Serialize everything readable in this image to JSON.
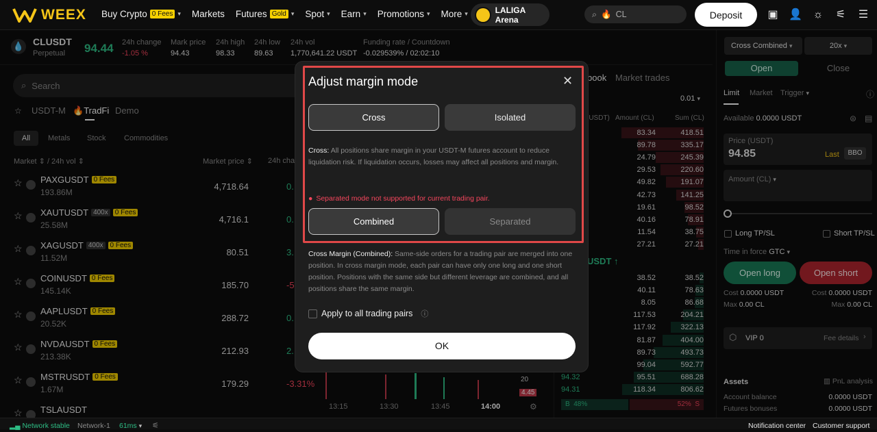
{
  "nav": {
    "brand": "WEEX",
    "items": [
      {
        "label": "Buy Crypto",
        "tag": "0 Fees",
        "chevron": true
      },
      {
        "label": "Markets"
      },
      {
        "label": "Futures",
        "tag": "Gold",
        "chevron": true
      },
      {
        "label": "Spot",
        "chevron": true
      },
      {
        "label": "Earn",
        "chevron": true
      },
      {
        "label": "Promotions",
        "chevron": true
      },
      {
        "label": "More",
        "chevron": true
      }
    ],
    "arena_label": "LALIGA Arena",
    "search_value": "CL",
    "deposit_label": "Deposit"
  },
  "ticker": {
    "symbol": "CLUSDT",
    "type": "Perpetual",
    "last_price": "94.44",
    "stats": [
      {
        "label": "24h change",
        "value": "-1.05 %",
        "tone": "red"
      },
      {
        "label": "Mark price",
        "value": "94.43"
      },
      {
        "label": "24h high",
        "value": "98.33"
      },
      {
        "label": "24h low",
        "value": "89.63"
      },
      {
        "label": "24h vol",
        "value": "1,770,641.22 USDT"
      },
      {
        "label": "Funding rate / Countdown",
        "value": "-0.029539% / 02:02:10"
      }
    ]
  },
  "market_list": {
    "search_placeholder": "Search",
    "tabs": [
      "USDT-M",
      "TradFi",
      "Demo"
    ],
    "active_tab": "TradFi",
    "filters": [
      "All",
      "Metals",
      "Stock",
      "Commodities"
    ],
    "col_market": "Market ⇕ / 24h vol ⇕",
    "col_price": "Market price ⇕",
    "col_change": "24h chan",
    "rows": [
      {
        "symbol": "PAXGUSDT",
        "lev": "",
        "fees": "0 Fees",
        "vol": "193.86M",
        "price": "4,718.64",
        "change": "0.",
        "tone": "green"
      },
      {
        "symbol": "XAUTUSDT",
        "lev": "400x",
        "fees": "0 Fees",
        "vol": "25.58M",
        "price": "4,716.1",
        "change": "0.",
        "tone": "green"
      },
      {
        "symbol": "XAGUSDT",
        "lev": "400x",
        "fees": "0 Fees",
        "vol": "11.52M",
        "price": "80.51",
        "change": "3.",
        "tone": "green"
      },
      {
        "symbol": "COINUSDT",
        "lev": "",
        "fees": "0 Fees",
        "vol": "145.14K",
        "price": "185.70",
        "change": "-5.",
        "tone": "red"
      },
      {
        "symbol": "AAPLUSDT",
        "lev": "",
        "fees": "0 Fees",
        "vol": "20.52K",
        "price": "288.72",
        "change": "0.",
        "tone": "green"
      },
      {
        "symbol": "NVDAUSDT",
        "lev": "",
        "fees": "0 Fees",
        "vol": "213.38K",
        "price": "212.93",
        "change": "2.",
        "tone": "green"
      },
      {
        "symbol": "MSTRUSDT",
        "lev": "",
        "fees": "0 Fees",
        "vol": "1.67M",
        "price": "179.29",
        "change": "-3.31%",
        "tone": "red"
      },
      {
        "symbol": "TSLAUSDT",
        "lev": "",
        "fees": "",
        "vol": "",
        "price": "",
        "change": "",
        "tone": "green"
      }
    ]
  },
  "chart": {
    "times": [
      "13:15",
      "13:30",
      "13:45",
      "14:00"
    ],
    "labels": [
      "20",
      "4.45"
    ]
  },
  "orderbook": {
    "tabs": [
      "book",
      "Market trades"
    ],
    "precision": "0.01",
    "headers": [
      "(USDT)",
      "Amount (CL)",
      "Sum (CL)"
    ],
    "asks": [
      {
        "amount": "83.34",
        "sum": "418.51"
      },
      {
        "amount": "89.78",
        "sum": "335.17"
      },
      {
        "amount": "24.79",
        "sum": "245.39"
      },
      {
        "amount": "29.53",
        "sum": "220.60"
      },
      {
        "amount": "49.82",
        "sum": "191.07"
      },
      {
        "amount": "42.73",
        "sum": "141.25"
      },
      {
        "amount": "19.61",
        "sum": "98.52"
      },
      {
        "amount": "40.16",
        "sum": "78.91"
      },
      {
        "amount": "11.54",
        "sum": "38.75"
      },
      {
        "amount": "27.21",
        "sum": "27.21"
      }
    ],
    "mid": "USDT ↑",
    "bids": [
      {
        "price": "",
        "amount": "38.52",
        "sum": "38.52"
      },
      {
        "price": "",
        "amount": "40.11",
        "sum": "78.63"
      },
      {
        "price": "",
        "amount": "8.05",
        "sum": "86.68"
      },
      {
        "price": "",
        "amount": "117.53",
        "sum": "204.21"
      },
      {
        "price": "",
        "amount": "117.92",
        "sum": "322.13"
      },
      {
        "price": "",
        "amount": "81.87",
        "sum": "404.00"
      },
      {
        "price": "",
        "amount": "89.73",
        "sum": "493.73"
      },
      {
        "price": "",
        "amount": "99.04",
        "sum": "592.77"
      },
      {
        "price": "94.32",
        "amount": "95.51",
        "sum": "688.28"
      },
      {
        "price": "94.31",
        "amount": "118.34",
        "sum": "806.62"
      }
    ],
    "buy_ratio": "48%",
    "sell_ratio": "52%",
    "buy_letter": "B",
    "sell_letter": "S"
  },
  "trade": {
    "margin_mode": "Cross Combined",
    "leverage": "20x",
    "open_label": "Open",
    "close_label": "Close",
    "order_types": [
      "Limit",
      "Market",
      "Trigger"
    ],
    "available_label": "Available",
    "available_value": "0.0000 USDT",
    "price_label": "Price (USDT)",
    "price_value": "94.85",
    "last_label": "Last",
    "bbo_label": "BBO",
    "amount_label": "Amount (CL)",
    "long_tpsl": "Long TP/SL",
    "short_tpsl": "Short TP/SL",
    "tif_label": "Time in force",
    "tif_value": "GTC",
    "open_long": "Open long",
    "open_short": "Open short",
    "cost_label": "Cost",
    "cost_long": "0.0000 USDT",
    "cost_short": "0.0000 USDT",
    "max_label": "Max",
    "max_long": "0.00 CL",
    "max_short": "0.00 CL",
    "vip_label": "VIP 0",
    "fee_details": "Fee details",
    "assets_title": "Assets",
    "pnl_analysis": "PnL analysis",
    "account_balance_label": "Account balance",
    "account_balance_value": "0.0000 USDT",
    "futures_bonus_label": "Futures bonuses",
    "futures_bonus_value": "0.0000 USDT"
  },
  "modal": {
    "title": "Adjust margin mode",
    "mode_cross": "Cross",
    "mode_isolated": "Isolated",
    "cross_desc_label": "Cross:",
    "cross_desc": "All positions share margin in your USDT-M futures account to reduce liquidation risk. If liquidation occurs, losses may affect all positions and margin.",
    "error_text": "Separated mode not supported for current trading pair.",
    "pos_combined": "Combined",
    "pos_separated": "Separated",
    "combined_desc_label": "Cross Margin (Combined):",
    "combined_desc": "Same-side orders for a trading pair are merged into one position. In cross margin mode, each pair can have only one long and one short position. Positions with the same side but different leverage are combined, and all positions share the same margin.",
    "apply_all_label": "Apply to all trading pairs",
    "ok_label": "OK"
  },
  "status": {
    "network": "Network stable",
    "node": "Network-1",
    "latency": "61ms",
    "notification": "Notification center",
    "support": "Customer support"
  },
  "colors": {
    "brand": "#f5c518",
    "green": "#2ebd85",
    "red": "#f6465d",
    "modal_bg": "#1e1e1e",
    "highlight": "#e04848"
  }
}
